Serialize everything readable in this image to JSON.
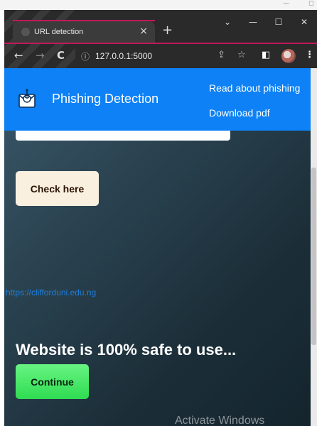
{
  "os": {
    "minimize": "—",
    "maximize": "◻"
  },
  "browser": {
    "tab_title": "URL detection",
    "tab_close": "×",
    "new_tab": "+",
    "window_controls": [
      "⌄",
      "—",
      "☐",
      "✕"
    ],
    "back": "←",
    "forward": "→",
    "reload": "C",
    "info_icon": "ⓘ",
    "url": "127.0.0.1:5000",
    "share_icon": "⇪",
    "star_icon": "☆",
    "sidepanel_icon": "◧",
    "menu_icon": "⋮"
  },
  "navbar": {
    "brand": "Phishing Detection",
    "links": [
      "Read about phishing",
      "Download pdf"
    ]
  },
  "form": {
    "url_value": "",
    "check_label": "Check here"
  },
  "result": {
    "checked_url": "https://clifforduni.edu.ng",
    "message": "Website is 100% safe to use...",
    "continue_label": "Continue"
  },
  "watermark": "Activate Windows",
  "colors": {
    "navbar": "#0d81f5",
    "check_button": "#faf0e0",
    "continue_button": "#35de57",
    "link": "#1f7dd8",
    "tab_accent": "#c2185b"
  }
}
